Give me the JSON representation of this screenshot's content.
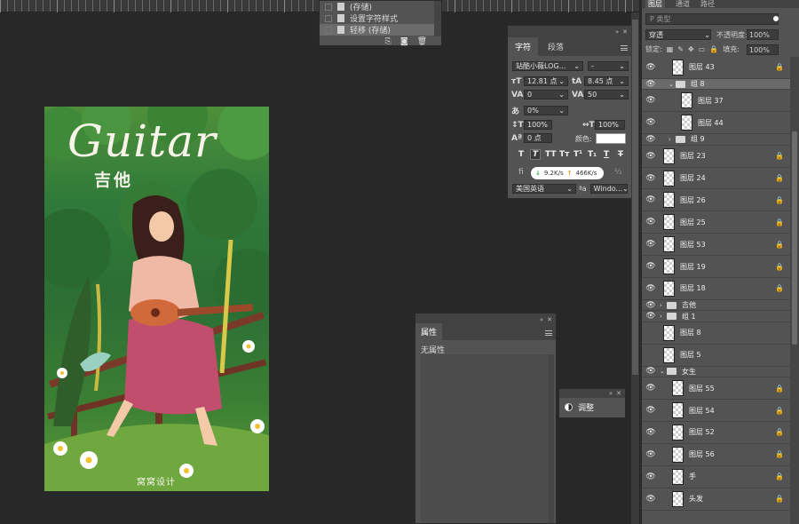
{
  "artwork": {
    "title_latin": "Guitar",
    "title_cn": "吉他",
    "signature": "窝窝设计"
  },
  "history": {
    "items": [
      {
        "label": "(存储)",
        "selected": false
      },
      {
        "label": "设置字符样式",
        "selected": false
      },
      {
        "label": "轻移 (存储)",
        "selected": true
      }
    ],
    "footer_icons": [
      "new-doc-icon",
      "camera-icon",
      "trash-icon"
    ]
  },
  "character": {
    "tabs": [
      "字符",
      "段落"
    ],
    "font_family": "站酷小薇LOG...",
    "font_style": "-",
    "font_size": "12.81 点",
    "leading": "8.45 点",
    "kerning": "0",
    "tracking": "50",
    "tsume": "0%",
    "vscale": "100%",
    "hscale": "100%",
    "baseline": "0 点",
    "color_label": "颜色:",
    "color": "#ffffff",
    "style_buttons": [
      "T",
      "T",
      "TT",
      "Tт",
      "T¹",
      "T₁",
      "T",
      "T"
    ],
    "language": "美国英语",
    "aa_label": "ªa",
    "aa_value": "Windo...",
    "net_down": "9.2K/s",
    "net_up": "466K/s"
  },
  "properties": {
    "tab": "属性",
    "content": "无属性"
  },
  "adjustments": {
    "label": "调整"
  },
  "layers_panel": {
    "tabs": [
      "图层",
      "通道",
      "路径"
    ],
    "filter_placeholder": "P 类型",
    "blend_mode": "穿透",
    "opacity_label": "不透明度:",
    "opacity": "100%",
    "lock_label": "锁定:",
    "fill_label": "填充:",
    "fill": "100%",
    "layers": [
      {
        "name": "图层 43",
        "type": "layer",
        "indent": 1,
        "visible": true,
        "locked": true,
        "selected": false
      },
      {
        "name": "组 8",
        "type": "group",
        "indent": 1,
        "visible": true,
        "locked": false,
        "selected": true,
        "expanded": true
      },
      {
        "name": "图层 37",
        "type": "layer",
        "indent": 2,
        "visible": true,
        "locked": false,
        "selected": false
      },
      {
        "name": "图层 44",
        "type": "layer",
        "indent": 2,
        "visible": true,
        "locked": false,
        "selected": false
      },
      {
        "name": "组 9",
        "type": "group",
        "indent": 1,
        "visible": true,
        "locked": false,
        "selected": false,
        "expanded": false
      },
      {
        "name": "图层 23",
        "type": "layer",
        "indent": 0,
        "visible": true,
        "locked": true,
        "selected": false
      },
      {
        "name": "图层 24",
        "type": "layer",
        "indent": 0,
        "visible": true,
        "locked": true,
        "selected": false
      },
      {
        "name": "图层 26",
        "type": "layer",
        "indent": 0,
        "visible": true,
        "locked": true,
        "selected": false
      },
      {
        "name": "图层 25",
        "type": "layer",
        "indent": 0,
        "visible": true,
        "locked": true,
        "selected": false
      },
      {
        "name": "图层 53",
        "type": "layer",
        "indent": 0,
        "visible": true,
        "locked": true,
        "selected": false
      },
      {
        "name": "图层 19",
        "type": "layer",
        "indent": 0,
        "visible": true,
        "locked": true,
        "selected": false
      },
      {
        "name": "图层 18",
        "type": "layer",
        "indent": 0,
        "visible": true,
        "locked": true,
        "selected": false
      },
      {
        "name": "吉他",
        "type": "group",
        "indent": 0,
        "visible": true,
        "locked": false,
        "selected": false,
        "expanded": false
      },
      {
        "name": "组 1",
        "type": "group",
        "indent": 0,
        "visible": true,
        "locked": false,
        "selected": false,
        "expanded": false
      },
      {
        "name": "图层 8",
        "type": "layer",
        "indent": 0,
        "visible": false,
        "locked": false,
        "selected": false
      },
      {
        "name": "图层 5",
        "type": "layer",
        "indent": 0,
        "visible": false,
        "locked": false,
        "selected": false
      },
      {
        "name": "女生",
        "type": "group",
        "indent": 0,
        "visible": true,
        "locked": false,
        "selected": false,
        "expanded": true
      },
      {
        "name": "图层 55",
        "type": "layer",
        "indent": 1,
        "visible": true,
        "locked": true,
        "selected": false
      },
      {
        "name": "图层 54",
        "type": "layer",
        "indent": 1,
        "visible": true,
        "locked": true,
        "selected": false
      },
      {
        "name": "图层 52",
        "type": "layer",
        "indent": 1,
        "visible": true,
        "locked": true,
        "selected": false
      },
      {
        "name": "图层 56",
        "type": "layer",
        "indent": 1,
        "visible": true,
        "locked": true,
        "selected": false
      },
      {
        "name": "手",
        "type": "layer",
        "indent": 1,
        "visible": true,
        "locked": true,
        "selected": false
      },
      {
        "name": "头发",
        "type": "layer",
        "indent": 1,
        "visible": true,
        "locked": true,
        "selected": false
      }
    ]
  }
}
